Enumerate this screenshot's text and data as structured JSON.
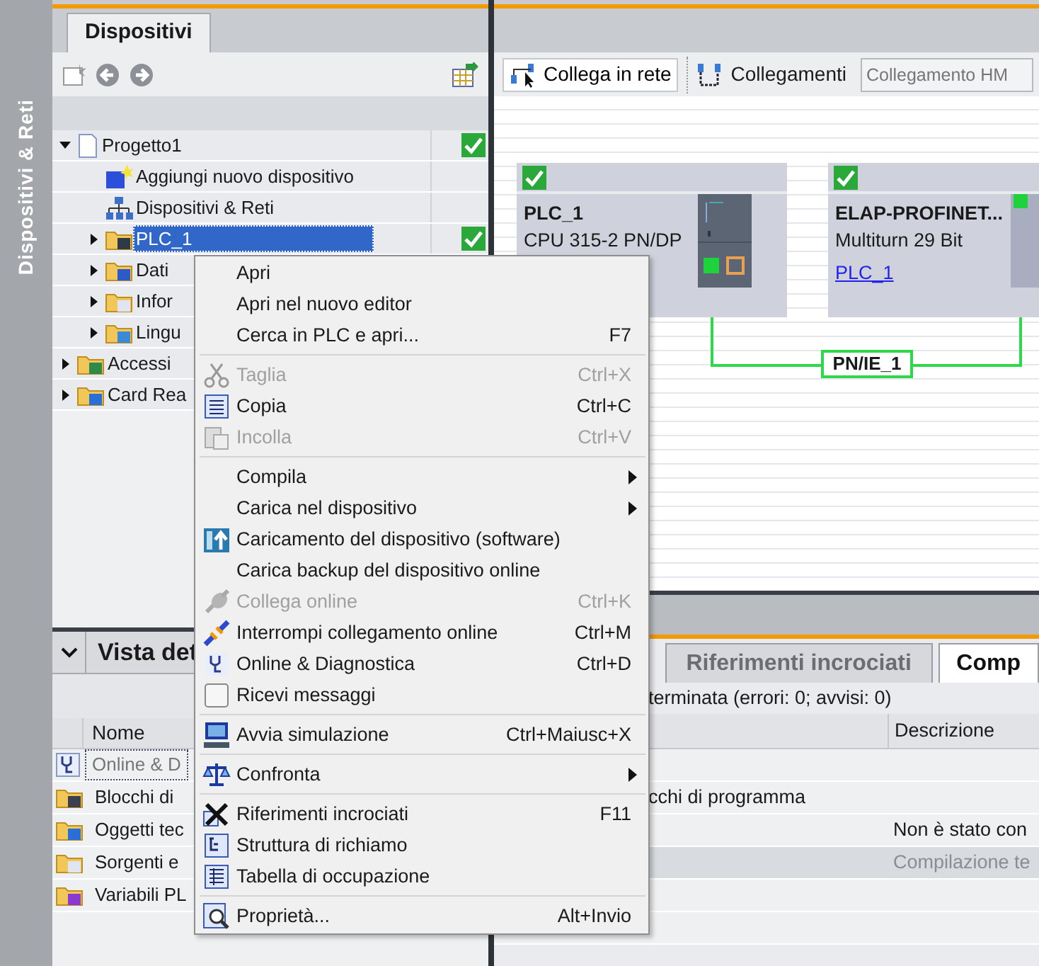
{
  "sidebar": {
    "title": "Dispositivi & Reti"
  },
  "project_tree": {
    "tab": "Dispositivi",
    "items": [
      {
        "kind": "folder",
        "label": "Progetto1",
        "expanded": true,
        "selected": false,
        "compiled": true,
        "children": [
          {
            "kind": "leaf",
            "label": "Aggiungi nuovo dispositivo",
            "selected": false,
            "compiled": false
          },
          {
            "kind": "leaf",
            "label": "Dispositivi & Reti",
            "selected": false,
            "compiled": false
          },
          {
            "kind": "folder",
            "label": "PLC_1",
            "expanded": false,
            "selected": true,
            "compiled": true
          },
          {
            "kind": "folder",
            "label": "Dati",
            "expanded": false,
            "selected": false,
            "compiled": false
          },
          {
            "kind": "folder",
            "label": "Infor",
            "expanded": false,
            "selected": false,
            "compiled": false
          },
          {
            "kind": "folder",
            "label": "Lingu",
            "expanded": false,
            "selected": false,
            "compiled": false
          }
        ]
      },
      {
        "kind": "folder",
        "label": "Accessi",
        "expanded": false,
        "selected": false,
        "compiled": false
      },
      {
        "kind": "folder",
        "label": "Card Rea",
        "expanded": false,
        "selected": false,
        "compiled": false
      }
    ]
  },
  "detail_view": {
    "title": "Vista det",
    "columns": [
      "Nome"
    ],
    "rows": [
      {
        "label": "Online & D",
        "selected": true
      },
      {
        "label": "Blocchi di",
        "selected": false
      },
      {
        "label": "Oggetti tec",
        "selected": false
      },
      {
        "label": "Sorgenti e",
        "selected": false
      },
      {
        "label": "Variabili PL",
        "selected": false
      }
    ]
  },
  "network_view": {
    "toolbar": {
      "connect_button": "Collega in rete",
      "connections_label": "Collegamenti",
      "connection_type": {
        "placeholder": "Collegamento HM"
      }
    },
    "devices": [
      {
        "kind": "plc",
        "name": "PLC_1",
        "type": "CPU 315-2 PN/DP",
        "compiled": true
      },
      {
        "kind": "encoder",
        "name": "ELAP-PROFINET...",
        "type": "Multiturn 29 Bit",
        "link": "PLC_1",
        "compiled": true
      }
    ],
    "network": {
      "label": "PN/IE_1"
    }
  },
  "inspector": {
    "tabs": [
      {
        "label": "Riferimenti incrociati",
        "selected": false
      },
      {
        "label": "Comp",
        "selected": true
      }
    ],
    "status": "terminata (errori: 0; avvisi: 0)",
    "columns": [
      "Descrizione"
    ],
    "rows": [
      {
        "message": "cchi di programma",
        "selected": false
      },
      {
        "description": "Non è stato con",
        "selected": false
      },
      {
        "description": "Compilazione te",
        "selected": true
      }
    ]
  },
  "context_menu": {
    "groups": [
      {
        "items": [
          {
            "kind": "command",
            "label": "Apri",
            "disabled": false,
            "submenu": false
          },
          {
            "kind": "command",
            "label": "Apri nel nuovo editor",
            "disabled": false,
            "submenu": false
          },
          {
            "kind": "command",
            "label": "Cerca in PLC e apri...",
            "shortcut": "F7",
            "disabled": false,
            "submenu": false
          }
        ]
      },
      {
        "items": [
          {
            "kind": "command",
            "label": "Taglia",
            "shortcut": "Ctrl+X",
            "disabled": true,
            "submenu": false
          },
          {
            "kind": "command",
            "label": "Copia",
            "shortcut": "Ctrl+C",
            "disabled": false,
            "submenu": false
          },
          {
            "kind": "command",
            "label": "Incolla",
            "shortcut": "Ctrl+V",
            "disabled": true,
            "submenu": false
          }
        ]
      },
      {
        "items": [
          {
            "kind": "command",
            "label": "Compila",
            "disabled": false,
            "submenu": true
          },
          {
            "kind": "command",
            "label": "Carica nel dispositivo",
            "disabled": false,
            "submenu": true
          },
          {
            "kind": "command",
            "label": "Caricamento del dispositivo (software)",
            "disabled": false,
            "submenu": false
          },
          {
            "kind": "command",
            "label": "Carica backup del dispositivo online",
            "disabled": false,
            "submenu": false
          },
          {
            "kind": "command",
            "label": "Collega online",
            "shortcut": "Ctrl+K",
            "disabled": true,
            "submenu": false
          },
          {
            "kind": "command",
            "label": "Interrompi collegamento online",
            "shortcut": "Ctrl+M",
            "disabled": false,
            "submenu": false
          },
          {
            "kind": "command",
            "label": "Online & Diagnostica",
            "shortcut": "Ctrl+D",
            "disabled": false,
            "submenu": false
          },
          {
            "kind": "check",
            "label": "Ricevi messaggi",
            "checked": false,
            "disabled": false,
            "submenu": false
          }
        ]
      },
      {
        "items": [
          {
            "kind": "command",
            "label": "Avvia simulazione",
            "shortcut": "Ctrl+Maiusc+X",
            "disabled": false,
            "submenu": false
          }
        ]
      },
      {
        "items": [
          {
            "kind": "command",
            "label": "Confronta",
            "disabled": false,
            "submenu": true
          }
        ]
      },
      {
        "items": [
          {
            "kind": "command",
            "label": "Riferimenti incrociati",
            "shortcut": "F11",
            "disabled": false,
            "submenu": false
          },
          {
            "kind": "command",
            "label": "Struttura di richiamo",
            "disabled": false,
            "submenu": false
          },
          {
            "kind": "command",
            "label": "Tabella di occupazione",
            "disabled": false,
            "submenu": false
          }
        ]
      },
      {
        "items": [
          {
            "kind": "command",
            "label": "Proprietà...",
            "shortcut": "Alt+Invio",
            "disabled": false,
            "submenu": false
          }
        ]
      }
    ]
  }
}
